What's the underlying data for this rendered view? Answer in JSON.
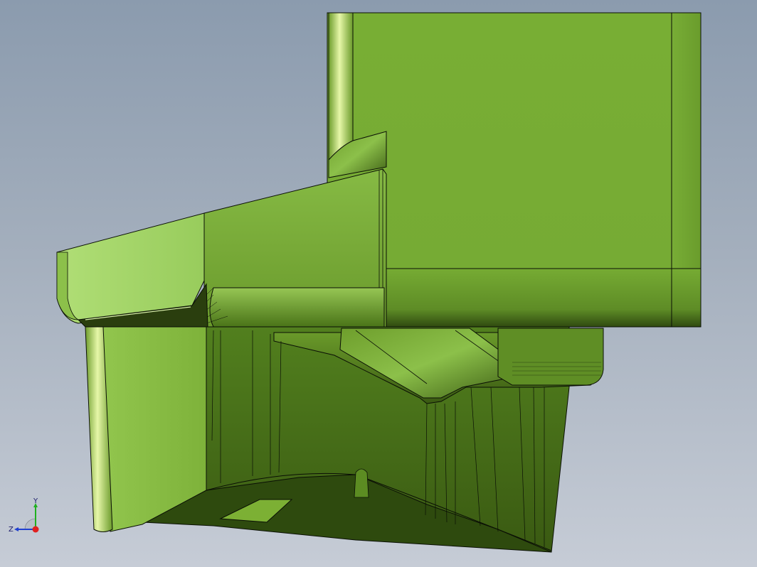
{
  "viewport": {
    "background_top": "#8b9bae",
    "background_bottom": "#c6ccd6",
    "model_color": "#7aad35",
    "model_shadow_color": "#3f5f18",
    "edge_color": "#0a0f05"
  },
  "view_triad": {
    "icon": "view-triad-icon",
    "axes": {
      "y_label": "Y",
      "z_label": "Z"
    },
    "colors": {
      "x": "#e02020",
      "y": "#20b020",
      "z": "#2040d0"
    }
  }
}
